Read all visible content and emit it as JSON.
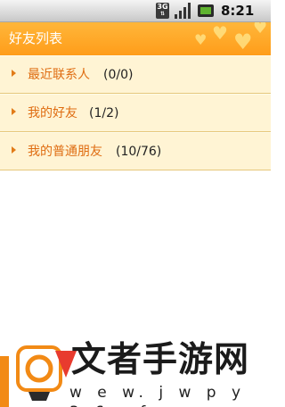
{
  "status_bar": {
    "network_badge": "3G",
    "time": "8:21 AM",
    "icons": [
      "network-3g-icon",
      "signal-strength-icon",
      "battery-charging-icon"
    ]
  },
  "header": {
    "title": "好友列表"
  },
  "groups": [
    {
      "name": "最近联系人",
      "count": "(0/0)"
    },
    {
      "name": "我的好友",
      "count": "(1/2)"
    },
    {
      "name": "我的普通朋友",
      "count": "(10/76)"
    }
  ],
  "watermark": {
    "text": "文者手游网",
    "url": "w e w. j w p y 3 6 . f o"
  },
  "colors": {
    "title_bar": "#ffa42a",
    "group_row_bg": "#fff4d4",
    "group_name": "#df6d12",
    "divider": "#e6c77c"
  }
}
